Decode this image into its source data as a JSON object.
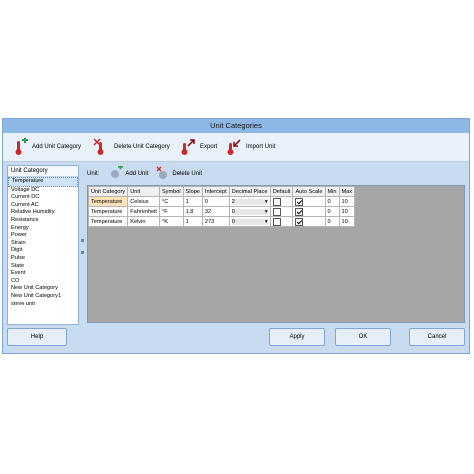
{
  "window": {
    "title": "Unit Categories"
  },
  "toolbar": {
    "add_category": "Add Unit Category",
    "delete_category": "Delete Unit Category",
    "export": "Export",
    "import": "Import Unit"
  },
  "categories": {
    "header": "Unit Category",
    "items": [
      "Temperature",
      "Voltage DC",
      "Current DC",
      "Current AC",
      "Relative Humidity",
      "Resistance",
      "Energy",
      "Power",
      "Strain",
      "Digit",
      "Pulse",
      "State",
      "Event",
      "CO",
      "New Unit Category",
      "New Unit Category1",
      "steve unit"
    ]
  },
  "units": {
    "label": "Unit:",
    "add": "Add Unit",
    "delete": "Delete Unit",
    "columns": [
      "Unit Category",
      "Unit",
      "Symbol",
      "Slope",
      "Intercept",
      "Decimal Place",
      "Default",
      "Auto Scale",
      "Min",
      "Max"
    ],
    "rows": [
      {
        "category": "Temperature",
        "unit": "Celsius",
        "symbol": "°C",
        "slope": "1",
        "intercept": "0",
        "decimal": "2",
        "default": false,
        "auto": true,
        "min": "0",
        "max": "10"
      },
      {
        "category": "Temperature",
        "unit": "Fahrenheit",
        "symbol": "°F",
        "slope": "1.8",
        "intercept": "32",
        "decimal": "0",
        "default": false,
        "auto": true,
        "min": "0",
        "max": "10"
      },
      {
        "category": "Temperature",
        "unit": "Kelvin",
        "symbol": "°K",
        "slope": "1",
        "intercept": "273",
        "decimal": "0",
        "default": false,
        "auto": true,
        "min": "0",
        "max": "10"
      }
    ]
  },
  "buttons": {
    "help": "Help",
    "apply": "Apply",
    "ok": "OK",
    "cancel": "Cancel"
  }
}
